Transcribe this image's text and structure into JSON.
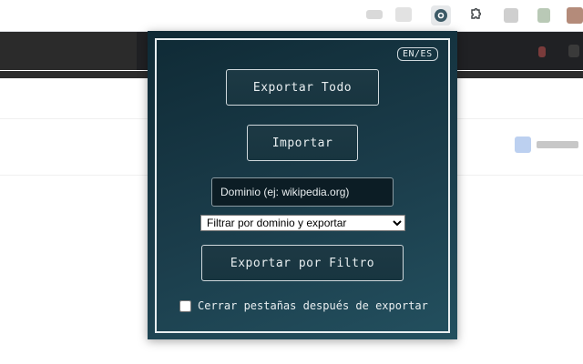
{
  "browser": {
    "toolbar_icons": [
      "extension-active-icon",
      "puzzle-icon"
    ]
  },
  "popup": {
    "lang_toggle": "EN/ES",
    "export_all_label": "Exportar Todo",
    "import_label": "Importar",
    "domain_placeholder": "Dominio (ej: wikipedia.org)",
    "domain_value": "",
    "filter_select": {
      "selected": "Filtrar por dominio y exportar",
      "options": [
        "Filtrar por dominio y exportar"
      ]
    },
    "export_filter_label": "Exportar por Filtro",
    "close_tabs_label": "Cerrar pestañas después de exportar",
    "close_tabs_checked": false
  },
  "colors": {
    "popup_bg_top": "#0f2a35",
    "popup_bg_bottom": "#23505f",
    "popup_border": "#e8eef0",
    "tabstrip": "#202124"
  }
}
